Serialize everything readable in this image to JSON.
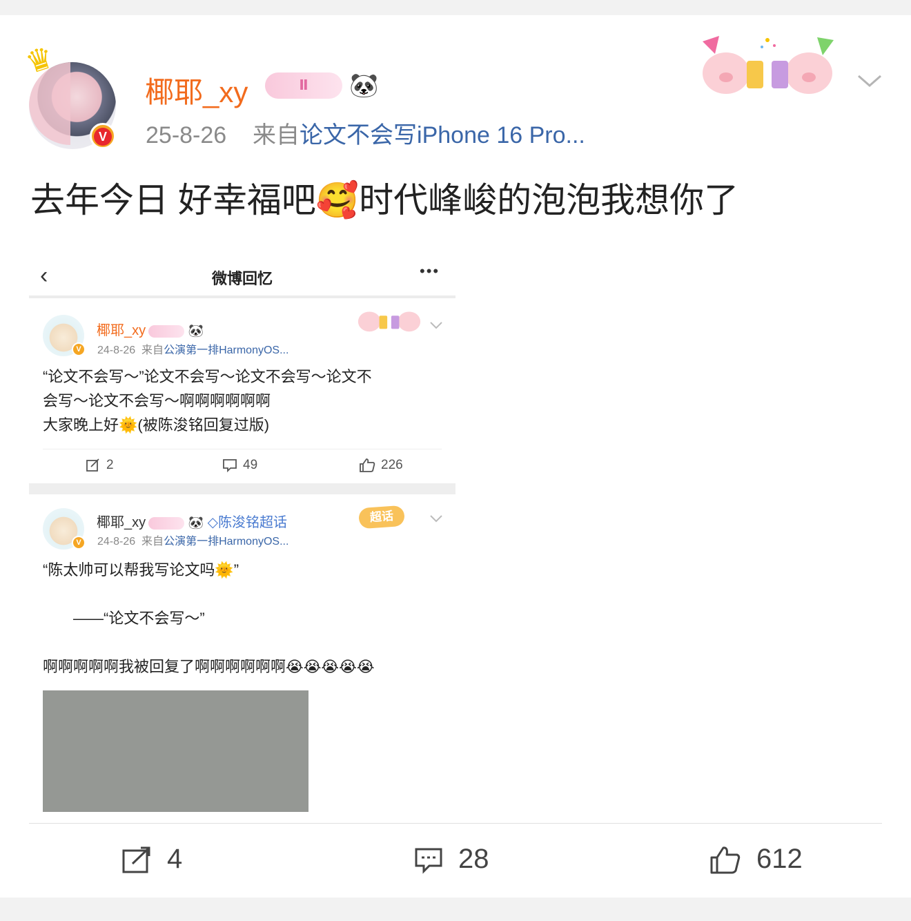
{
  "post": {
    "username": "椰耶_xy",
    "member_level": "Ⅱ",
    "date": "25-8-26",
    "from_label": "来自",
    "source": "论文不会写iPhone 16 Pro...",
    "text_before_emoji": "去年今日 好幸福吧",
    "emoji": "🥰",
    "text_after_emoji": "时代峰峻的泡泡我想你了"
  },
  "memory_shot": {
    "nav_title": "微博回忆",
    "back_glyph": "‹",
    "more_glyph": "•••",
    "post1": {
      "username": "椰耶_xy",
      "date": "24-8-26",
      "from_label": "来自",
      "source": "公演第一排HarmonyOS...",
      "lines": [
        "“论文不会写～”论文不会写～论文不会写～论文不",
        "会写～论文不会写～啊啊啊啊啊啊",
        "大家晚上好🌞(被陈浚铭回复过版)"
      ],
      "reposts": "2",
      "comments": "49",
      "likes": "226"
    },
    "post2": {
      "username": "椰耶_xy",
      "supertopic": "陈浚铭超话",
      "supertopic_tag": "超话",
      "date": "24-8-26",
      "from_label": "来自",
      "source": "公演第一排HarmonyOS...",
      "line1": "“陈太帅可以帮我写论文吗🌞”",
      "line2": "——“论文不会写～”",
      "line3": "啊啊啊啊啊我被回复了啊啊啊啊啊啊😭😭😭😭😭"
    }
  },
  "actions": {
    "reposts": "4",
    "comments": "28",
    "likes": "612"
  },
  "colors": {
    "username_orange": "#f26b1d",
    "source_blue": "#3a66a8",
    "verified_badge": "#f5a623",
    "placeholder_gray": "#959894"
  },
  "icons": {
    "repost": "repost-icon",
    "comment": "comment-icon",
    "like": "thumbs-up-icon",
    "more": "chevron-down-icon"
  }
}
